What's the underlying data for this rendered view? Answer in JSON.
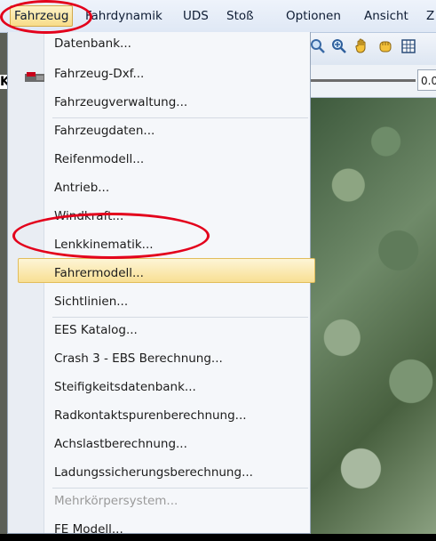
{
  "menubar": {
    "items": [
      "Fahrzeug",
      "Fahrdynamik",
      "UDS",
      "Stoß",
      "Optionen",
      "Ansicht",
      "Z"
    ],
    "active_index": 0
  },
  "left_glyph": "K",
  "toolbar": {
    "icons": [
      "search-icon",
      "zoom-icon",
      "hand-icon",
      "hand-grab-icon",
      "grid-icon"
    ],
    "zoom_value": "0.0"
  },
  "dropdown": {
    "items": [
      {
        "label": "Datenbank...",
        "enabled": true
      },
      {
        "label": "Fahrzeug-Dxf...",
        "enabled": true
      },
      {
        "label": "Fahrzeugverwaltung...",
        "enabled": true
      },
      {
        "label": "Fahrzeugdaten...",
        "enabled": true
      },
      {
        "label": "Reifenmodell...",
        "enabled": true
      },
      {
        "label": "Antrieb...",
        "enabled": true
      },
      {
        "label": "Windkraft...",
        "enabled": true
      },
      {
        "label": "Lenkkinematik...",
        "enabled": true,
        "highlighted": true
      },
      {
        "label": "Fahrermodell...",
        "enabled": true
      },
      {
        "label": "Sichtlinien...",
        "enabled": true
      },
      {
        "label": "EES Katalog...",
        "enabled": true
      },
      {
        "label": "Crash 3 - EBS Berechnung...",
        "enabled": true
      },
      {
        "label": "Steifigkeitsdatenbank...",
        "enabled": true
      },
      {
        "label": "Radkontaktspurenberechnung...",
        "enabled": true
      },
      {
        "label": "Achslastberechnung...",
        "enabled": true
      },
      {
        "label": "Ladungssicherungsberechnung...",
        "enabled": true
      },
      {
        "label": "Mehrkörpersystem...",
        "enabled": false
      },
      {
        "label": "FE Modell...",
        "enabled": true
      }
    ]
  },
  "colors": {
    "annotation_red": "#e3001b",
    "highlight": "#f8df93",
    "menubar": "#dfe8f5"
  }
}
